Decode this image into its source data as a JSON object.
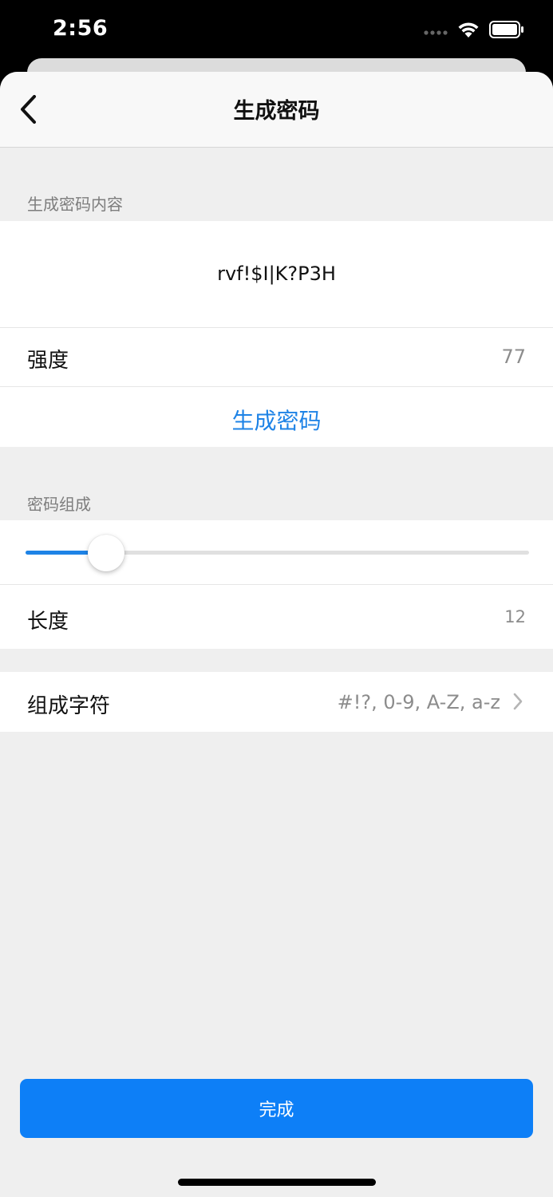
{
  "status_bar": {
    "time": "2:56",
    "icons": [
      "cellular-dots-icon",
      "wifi-icon",
      "battery-icon"
    ]
  },
  "nav": {
    "title": "生成密码",
    "back_icon": "chevron-left-icon"
  },
  "generated": {
    "section_header": "生成密码内容",
    "password": "rvf!$I|K?P3H",
    "strength_label": "强度",
    "strength_value": "77",
    "generate_label": "生成密码"
  },
  "composition": {
    "section_header": "密码组成",
    "length_label": "长度",
    "length_value": "12",
    "slider_fraction": 0.16,
    "charset_label": "组成字符",
    "charset_value": "#!?, 0-9, A-Z, a-z"
  },
  "footer": {
    "done_label": "完成"
  },
  "colors": {
    "accent": "#1e83e6",
    "button": "#0d7ff7",
    "background": "#efefef"
  }
}
